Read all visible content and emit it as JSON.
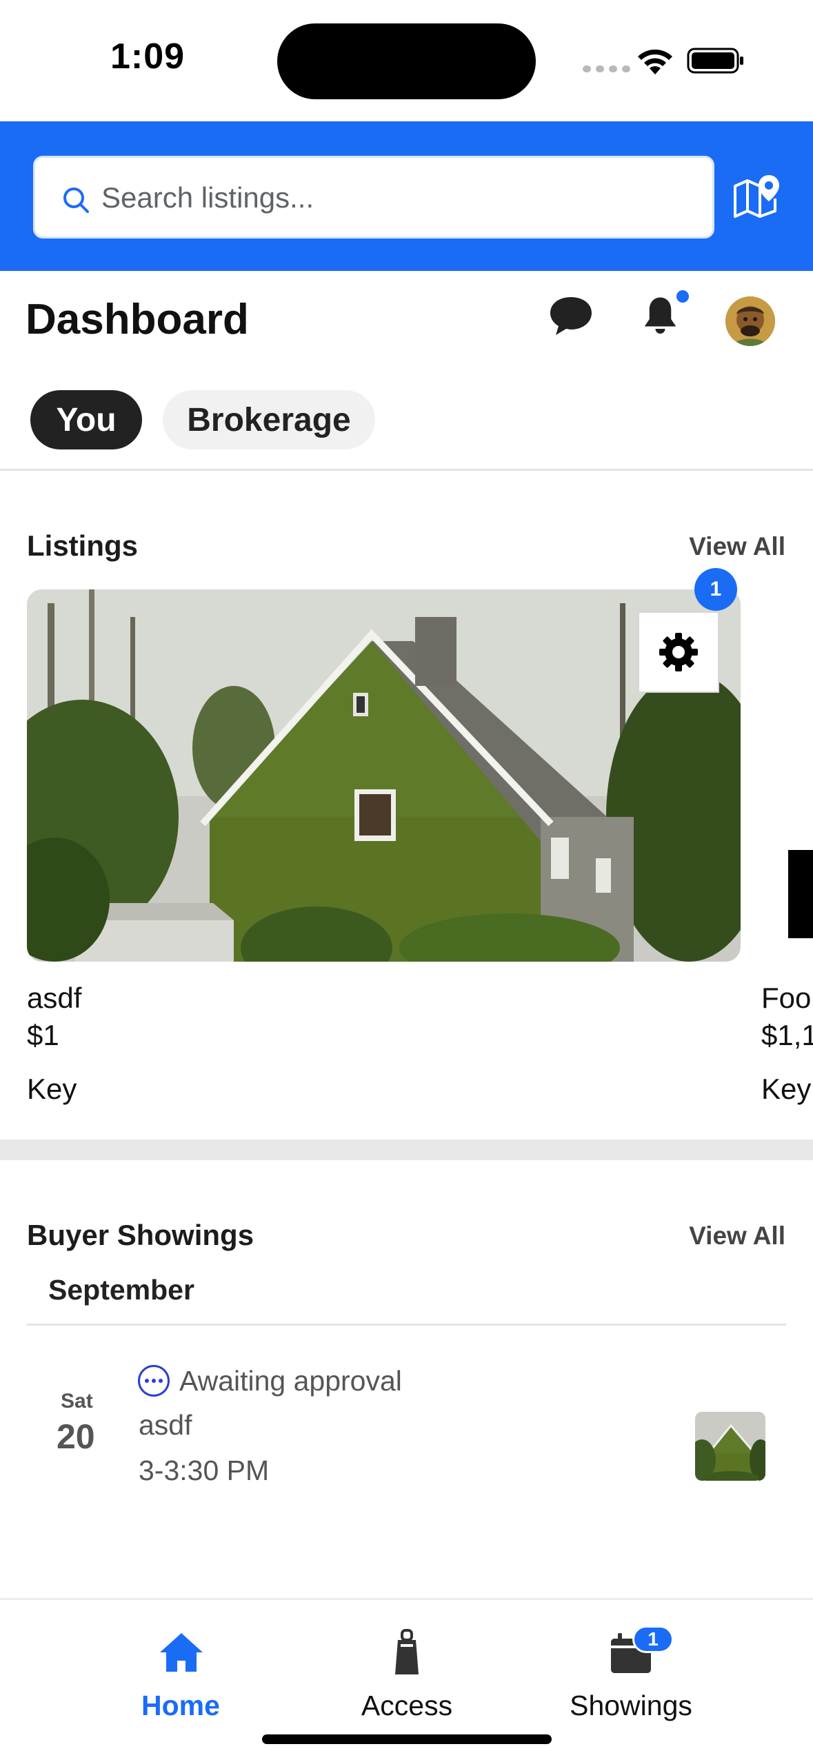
{
  "status_bar": {
    "time": "1:09"
  },
  "header": {
    "search_placeholder": "Search listings...",
    "accent_color": "#1a6cf5"
  },
  "dashboard": {
    "title": "Dashboard",
    "notification_dot": true
  },
  "segments": [
    {
      "label": "You",
      "selected": true
    },
    {
      "label": "Brokerage",
      "selected": false
    }
  ],
  "listings": {
    "title": "Listings",
    "view_all": "View All",
    "settings_badge": "1",
    "items": [
      {
        "name": "asdf",
        "price": "$1",
        "access": "Key"
      },
      {
        "name": "Foo",
        "price": "$1,1",
        "access": "Key"
      }
    ]
  },
  "buyer_showings": {
    "title": "Buyer Showings",
    "view_all": "View All",
    "month": "September",
    "items": [
      {
        "day": "Sat",
        "date": "20",
        "status": "Awaiting approval",
        "listing": "asdf",
        "time": "3-3:30 PM"
      }
    ]
  },
  "bottom_nav": {
    "items": [
      {
        "label": "Home",
        "icon": "home-icon",
        "active": true
      },
      {
        "label": "Access",
        "icon": "lockbox-icon",
        "active": false
      },
      {
        "label": "Showings",
        "icon": "calendar-icon",
        "active": false
      }
    ],
    "showings_badge": "1"
  }
}
